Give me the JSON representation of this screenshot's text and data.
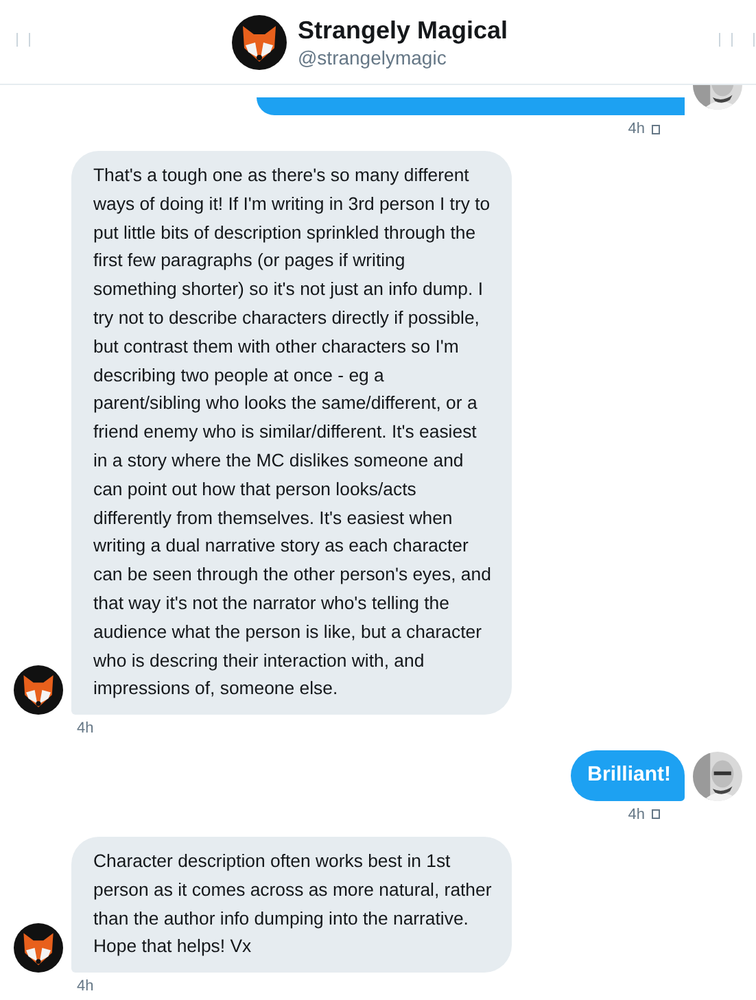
{
  "header": {
    "name": "Strangely Magical",
    "handle": "@strangelymagic"
  },
  "messages": [
    {
      "kind": "sent",
      "partial": true,
      "time": "4h"
    },
    {
      "kind": "received",
      "text": "That's a tough one as there's so many different ways of doing it! If I'm writing in 3rd person I try to put little bits of description sprinkled through the first few paragraphs (or pages if writing something shorter) so it's not just an info dump. I try not to describe characters directly if possible, but contrast them with other characters so I'm describing two people at once - eg a parent/sibling who looks the same/different, or a friend enemy who is similar/different. It's easiest in a story where the MC dislikes someone and can point out how that person looks/acts differently from themselves. It's easiest when writing a dual narrative story as each character can be seen through the other person's eyes, and that way it's not the narrator who's telling the audience what the person is like, but a character who is descring their interaction with, and impressions of, someone else.",
      "time": "4h"
    },
    {
      "kind": "sent",
      "text": "Brilliant!",
      "time": "4h"
    },
    {
      "kind": "received",
      "text": "Character description often works best in 1st person as it comes across as more natural, rather than the author info dumping into the narrative. Hope that helps! Vx",
      "time": "4h"
    }
  ]
}
